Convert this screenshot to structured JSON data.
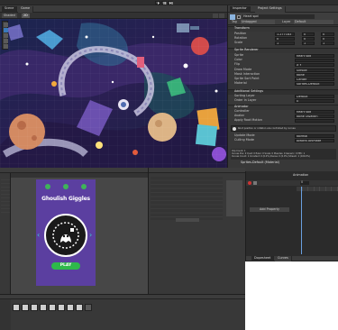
{
  "toolbar": {
    "play_icon": "play-icon",
    "pause_icon": "pause-icon",
    "step_icon": "step-icon"
  },
  "scene": {
    "tabs": [
      {
        "label": "Scene"
      },
      {
        "label": "Game"
      }
    ],
    "shading_mode": "Shaded",
    "dimension_toggle": "2D"
  },
  "inspector": {
    "tabs": [
      {
        "label": "Inspector"
      },
      {
        "label": "Project Settings"
      }
    ],
    "object_name": "Heart spd",
    "tag_label": "Tag",
    "tag_value": "Untagged",
    "layer_label": "Layer",
    "layer_value": "Default",
    "transform_header": "Transform",
    "transform_rows": [
      {
        "label": "Position",
        "values": [
          "X",
          "1.277183",
          "Y",
          "0",
          "Z",
          "0"
        ]
      },
      {
        "label": "Rotation",
        "values": [
          "X",
          "0",
          "Y",
          "0",
          "Z",
          "0"
        ]
      },
      {
        "label": "Scale",
        "values": [
          "X",
          "1",
          "Y",
          "1",
          "Z",
          "1"
        ]
      }
    ],
    "sprite_header": "Sprite Renderer",
    "sprite_rows": [
      {
        "label": "Sprite",
        "value": "heart spd"
      },
      {
        "label": "Color",
        "value": ""
      },
      {
        "label": "Flip",
        "value": "X  Y"
      },
      {
        "label": "Draw Mode",
        "value": "Simple"
      },
      {
        "label": "Mask Interaction",
        "value": "None"
      },
      {
        "label": "Sprite Sort Point",
        "value": "Center"
      },
      {
        "label": "Material",
        "value": "Sprites-Default"
      }
    ],
    "additional_header": "Additional Settings",
    "additional_rows": [
      {
        "label": "Sorting Layer",
        "value": "Default"
      },
      {
        "label": "Order in Layer",
        "value": "0"
      }
    ],
    "animator_header": "Animator",
    "animator_rows": [
      {
        "label": "Controller",
        "value": "heart spd"
      },
      {
        "label": "Avatar",
        "value": "None (Avatar)"
      },
      {
        "label": "Apply Root Motion",
        "value": ""
      }
    ],
    "help_text": "Root position or rotation are controlled by curves",
    "animator_rows2": [
      {
        "label": "Update Mode",
        "value": "Normal"
      },
      {
        "label": "Culling Mode",
        "value": "Always Animate"
      }
    ],
    "clip_info": "Clip Count: 1\nCurves Pos: 0 Quat: 0 Euler: 0 Scale: 0 Muscles: 0 Generic: 0 PPtr: 1\nCurves Count: 1 Constant: 0 (0.0%) Dense: 0 (0.0%) Stream: 1 (100.0%)",
    "material_label": "Sprites-Default (Material)",
    "shader_label": "Shader",
    "shader_value": "Sprites/Default"
  },
  "animation": {
    "title": "Animation",
    "add_property": "Add Property",
    "tabs": [
      {
        "label": "Dopesheet"
      },
      {
        "label": "Curves"
      }
    ],
    "time_value": "0"
  },
  "game_view": {
    "title": "Ghoulish Giggles",
    "button_label": "PLAY"
  },
  "project": {
    "tabs": [
      {
        "label": "Project"
      },
      {
        "label": "Console"
      }
    ],
    "asset_count": 9
  },
  "hierarchy": {
    "tabs": [
      {
        "label": "Hierarchy"
      }
    ]
  },
  "colors": {
    "editor_bg": "#383838",
    "panel_dark": "#282828",
    "accent": "#3a79bb",
    "game_bg": "#5b3fa0",
    "play_green": "#2eb84a"
  }
}
